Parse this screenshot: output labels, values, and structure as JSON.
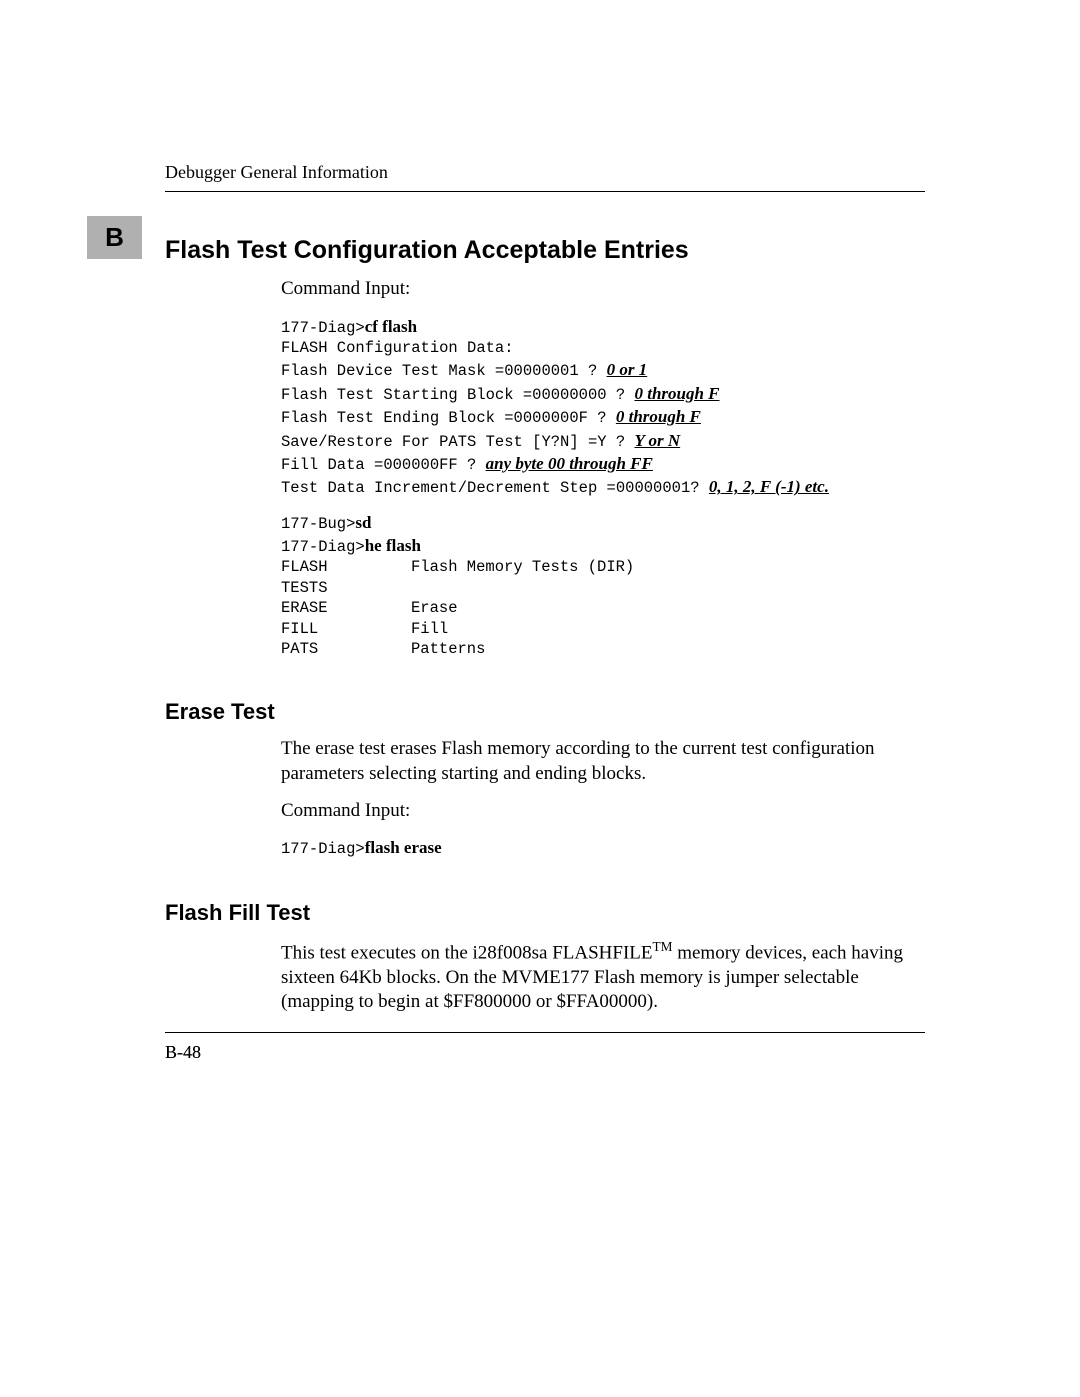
{
  "header": {
    "running_head": "Debugger General Information",
    "tab_letter": "B"
  },
  "section1": {
    "title": "Flash Test Configuration Acceptable Entries",
    "command_label": "Command Input:",
    "lines": {
      "p1_prompt": "177-Diag>",
      "p1_cmd": "cf flash",
      "l2": "FLASH Configuration Data:",
      "l3_text": "Flash Device Test Mask =00000001 ? ",
      "l3_entry": "0 or 1",
      "l4_text": "Flash Test Starting Block =00000000 ? ",
      "l4_entry": "0 through F",
      "l5_text": "Flash Test Ending Block =0000000F ? ",
      "l5_entry": "0 through F",
      "l6_text": "Save/Restore For PATS Test [Y?N] =Y ? ",
      "l6_entry": "Y or N",
      "l7_text": "Fill Data =000000FF ? ",
      "l7_entry": "any byte 00 through FF",
      "l8_text": "Test Data Increment/Decrement Step =00000001? ",
      "l8_entry": "0, 1, 2, F (-1) etc.",
      "p2_prompt": "177-Bug>",
      "p2_cmd": "sd",
      "p3_prompt": "177-Diag>",
      "p3_cmd": "he flash",
      "t1_col1": "FLASH",
      "t1_col2": "Flash Memory Tests (DIR)",
      "t2_col1": "TESTS",
      "t3_col1": "ERASE",
      "t3_col2": "Erase",
      "t4_col1": "FILL",
      "t4_col2": "Fill",
      "t5_col1": "PATS",
      "t5_col2": "Patterns"
    }
  },
  "section2": {
    "title": "Erase Test",
    "para": "The erase test erases Flash memory according to the current test configuration parameters selecting starting and ending blocks.",
    "command_label": "Command Input:",
    "prompt": "177-Diag>",
    "cmd": "flash erase"
  },
  "section3": {
    "title": "Flash Fill Test",
    "para_pre": "This test executes on the i28f008sa FLASHFILE",
    "tm": "TM",
    "para_post": " memory devices, each having sixteen 64Kb blocks. On the MVME177 Flash memory is jumper selectable (mapping to begin at $FF800000 or $FFA00000)."
  },
  "footer": {
    "pagenum": "B-48"
  }
}
